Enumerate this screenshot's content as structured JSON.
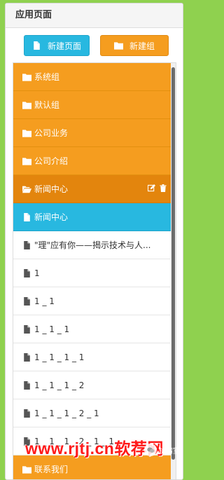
{
  "panel": {
    "title": "应用页面"
  },
  "toolbar": {
    "new_page_label": "新建页面",
    "new_group_label": "新建组"
  },
  "rows": [
    {
      "type": "group",
      "label": "系统组"
    },
    {
      "type": "group",
      "label": "默认组"
    },
    {
      "type": "group",
      "label": "公司业务"
    },
    {
      "type": "group",
      "label": "公司介绍"
    },
    {
      "type": "group-open",
      "label": "新闻中心"
    },
    {
      "type": "active",
      "label": "新闻中心"
    },
    {
      "type": "page",
      "label": "\"理\"应有你——揭示技术与人..."
    },
    {
      "type": "page",
      "label": "1"
    },
    {
      "type": "page",
      "label": "1 _ 1"
    },
    {
      "type": "page",
      "label": "1 _ 1 _ 1"
    },
    {
      "type": "page",
      "label": "1 _ 1 _ 1 _ 1"
    },
    {
      "type": "page",
      "label": "1 _ 1 _ 1 _ 2"
    },
    {
      "type": "page",
      "label": "1 _ 1 _ 1 _ 2 _ 1"
    },
    {
      "type": "page",
      "label": "1 _ 1 _ 1 _ 2 _ 1 _ 1"
    },
    {
      "type": "group",
      "label": "联系我们"
    }
  ],
  "watermark": {
    "site": "www.rjtj.cn软荐网",
    "wechat": "护晴室"
  },
  "colors": {
    "orange": "#f59d1f",
    "blue": "#28b8e0",
    "green": "#8fd14f"
  }
}
